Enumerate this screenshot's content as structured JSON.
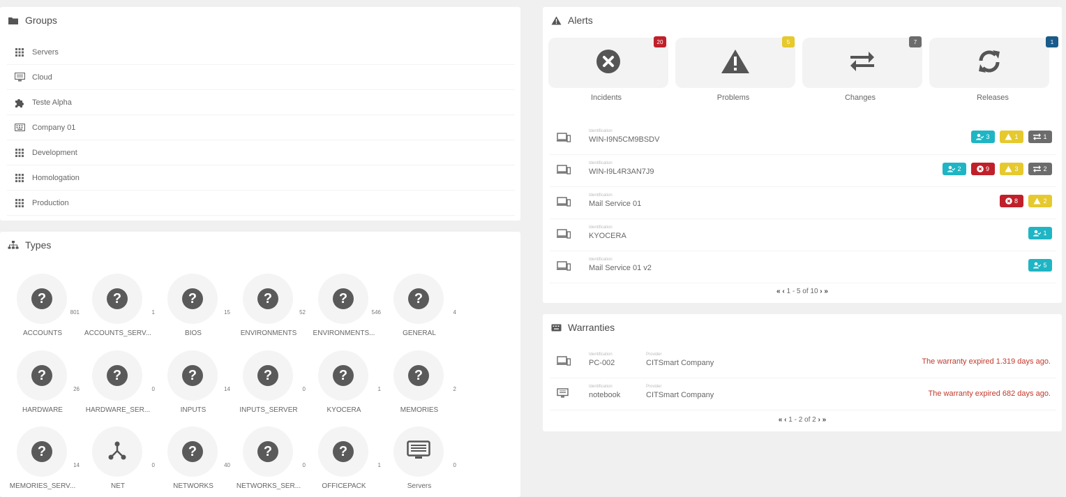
{
  "groups": {
    "title": "Groups",
    "items": [
      {
        "label": "Servers",
        "icon": "grid-icon"
      },
      {
        "label": "Cloud",
        "icon": "monitor-icon"
      },
      {
        "label": "Teste Alpha",
        "icon": "puzzle-icon"
      },
      {
        "label": "Company 01",
        "icon": "keyboard-icon"
      },
      {
        "label": "Development",
        "icon": "grid-icon"
      },
      {
        "label": "Homologation",
        "icon": "grid-icon"
      },
      {
        "label": "Production",
        "icon": "grid-icon"
      }
    ]
  },
  "types": {
    "title": "Types",
    "items": [
      {
        "label": "ACCOUNTS",
        "count": "801",
        "icon": "question-icon"
      },
      {
        "label": "ACCOUNTS_SERV...",
        "count": "1",
        "icon": "question-icon"
      },
      {
        "label": "BIOS",
        "count": "15",
        "icon": "question-icon"
      },
      {
        "label": "ENVIRONMENTS",
        "count": "52",
        "icon": "question-icon"
      },
      {
        "label": "ENVIRONMENTS...",
        "count": "546",
        "icon": "question-icon"
      },
      {
        "label": "GENERAL",
        "count": "4",
        "icon": "question-icon"
      },
      {
        "label": "HARDWARE",
        "count": "26",
        "icon": "question-icon"
      },
      {
        "label": "HARDWARE_SER...",
        "count": "0",
        "icon": "question-icon"
      },
      {
        "label": "INPUTS",
        "count": "14",
        "icon": "question-icon"
      },
      {
        "label": "INPUTS_SERVER",
        "count": "0",
        "icon": "question-icon"
      },
      {
        "label": "KYOCERA",
        "count": "1",
        "icon": "question-icon"
      },
      {
        "label": "MEMORIES",
        "count": "2",
        "icon": "question-icon"
      },
      {
        "label": "MEMORIES_SERV...",
        "count": "14",
        "icon": "question-icon"
      },
      {
        "label": "NET",
        "count": "0",
        "icon": "network-icon"
      },
      {
        "label": "NETWORKS",
        "count": "40",
        "icon": "question-icon"
      },
      {
        "label": "NETWORKS_SER...",
        "count": "0",
        "icon": "question-icon"
      },
      {
        "label": "OFFICEPACK",
        "count": "1",
        "icon": "question-icon"
      },
      {
        "label": "Servers",
        "count": "0",
        "icon": "server-list-icon"
      }
    ]
  },
  "alerts": {
    "title": "Alerts",
    "cards": [
      {
        "label": "Incidents",
        "count": "20",
        "color": "#c0202a",
        "icon": "times-circle-icon"
      },
      {
        "label": "Problems",
        "count": "5",
        "color": "#e6c92d",
        "icon": "warning-icon"
      },
      {
        "label": "Changes",
        "count": "7",
        "color": "#6c6c6c",
        "icon": "exchange-icon"
      },
      {
        "label": "Releases",
        "count": "1",
        "color": "#1a5b8a",
        "icon": "refresh-icon"
      }
    ],
    "rows": [
      {
        "caption": "Identification",
        "value": "WIN-I9N5CM9BSDV",
        "badges": [
          {
            "type": "cyan",
            "icon": "user-check-icon",
            "count": "3"
          },
          {
            "type": "yellow",
            "icon": "warning-icon",
            "count": "1"
          },
          {
            "type": "gray",
            "icon": "exchange-icon",
            "count": "1"
          }
        ]
      },
      {
        "caption": "Identification",
        "value": "WIN-I9L4R3AN7J9",
        "badges": [
          {
            "type": "cyan",
            "icon": "user-check-icon",
            "count": "2"
          },
          {
            "type": "red",
            "icon": "times-circle-icon",
            "count": "9"
          },
          {
            "type": "yellow",
            "icon": "warning-icon",
            "count": "3"
          },
          {
            "type": "gray",
            "icon": "exchange-icon",
            "count": "2"
          }
        ]
      },
      {
        "caption": "Identification",
        "value": "Mail Service 01",
        "badges": [
          {
            "type": "red",
            "icon": "times-circle-icon",
            "count": "8"
          },
          {
            "type": "yellow",
            "icon": "warning-icon",
            "count": "2"
          }
        ]
      },
      {
        "caption": "Identification",
        "value": "KYOCERA",
        "badges": [
          {
            "type": "cyan",
            "icon": "user-check-icon",
            "count": "1"
          }
        ]
      },
      {
        "caption": "Identification",
        "value": "Mail Service 01 v2",
        "badges": [
          {
            "type": "cyan",
            "icon": "user-check-icon",
            "count": "5"
          }
        ]
      }
    ],
    "pager": "1 - 5 of 10"
  },
  "warranties": {
    "title": "Warranties",
    "rows": [
      {
        "caption": "Identification",
        "value": "PC-002",
        "provider_caption": "Provider",
        "provider": "CITSmart Company",
        "status": "The warranty expired 1.319 days ago."
      },
      {
        "caption": "Identification",
        "value": "notebook",
        "provider_caption": "Provider",
        "provider": "CITSmart Company",
        "status": "The warranty expired 682 days ago."
      }
    ],
    "pager": "1 - 2 of 2"
  }
}
